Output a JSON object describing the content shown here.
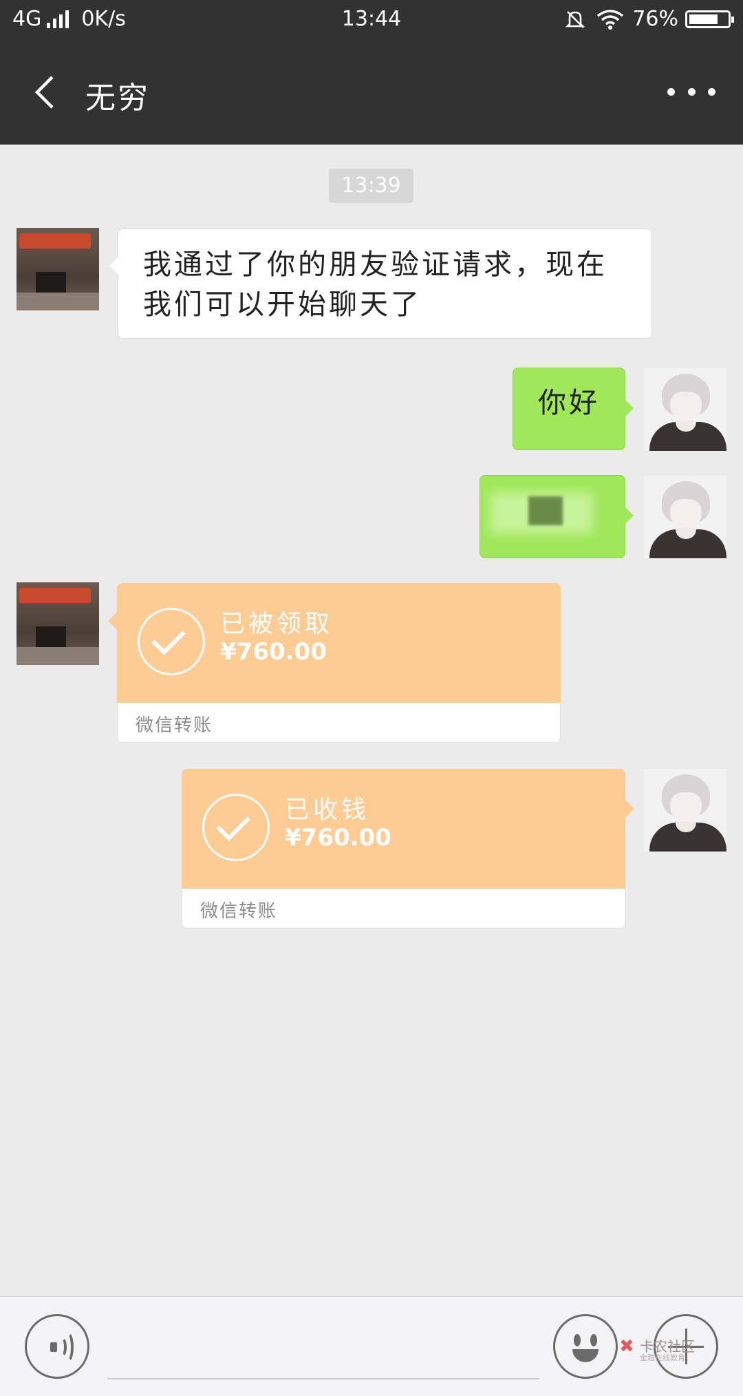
{
  "status_bar": {
    "network": "4G",
    "speed": "0K/s",
    "time": "13:44",
    "battery_percent": "76%",
    "battery_level": 0.76
  },
  "header": {
    "back_icon": "chevron-left-icon",
    "title": "无穷",
    "more_icon": "more-dots-icon"
  },
  "chat": {
    "timestamp": "13:39",
    "messages": [
      {
        "side": "left",
        "type": "text",
        "text": "我通过了你的朋友验证请求，现在我们可以开始聊天了"
      },
      {
        "side": "right",
        "type": "text",
        "text": "你好"
      },
      {
        "side": "right",
        "type": "blurred"
      },
      {
        "side": "left",
        "type": "transfer",
        "status": "已被领取",
        "amount": "¥760.00",
        "label": "微信转账"
      },
      {
        "side": "right",
        "type": "transfer",
        "status": "已收钱",
        "amount": "¥760.00",
        "label": "微信转账"
      }
    ]
  },
  "input_bar": {
    "voice_icon": "voice-icon",
    "emoji_icon": "emoji-icon",
    "plus_icon": "plus-icon",
    "watermark": "卡农社区",
    "watermark_sub": "金融在线教育"
  },
  "colors": {
    "header_bg": "#323232",
    "chat_bg": "#ebebeb",
    "green_bubble": "#a0e75a",
    "transfer_orange": "#fdcb94"
  }
}
